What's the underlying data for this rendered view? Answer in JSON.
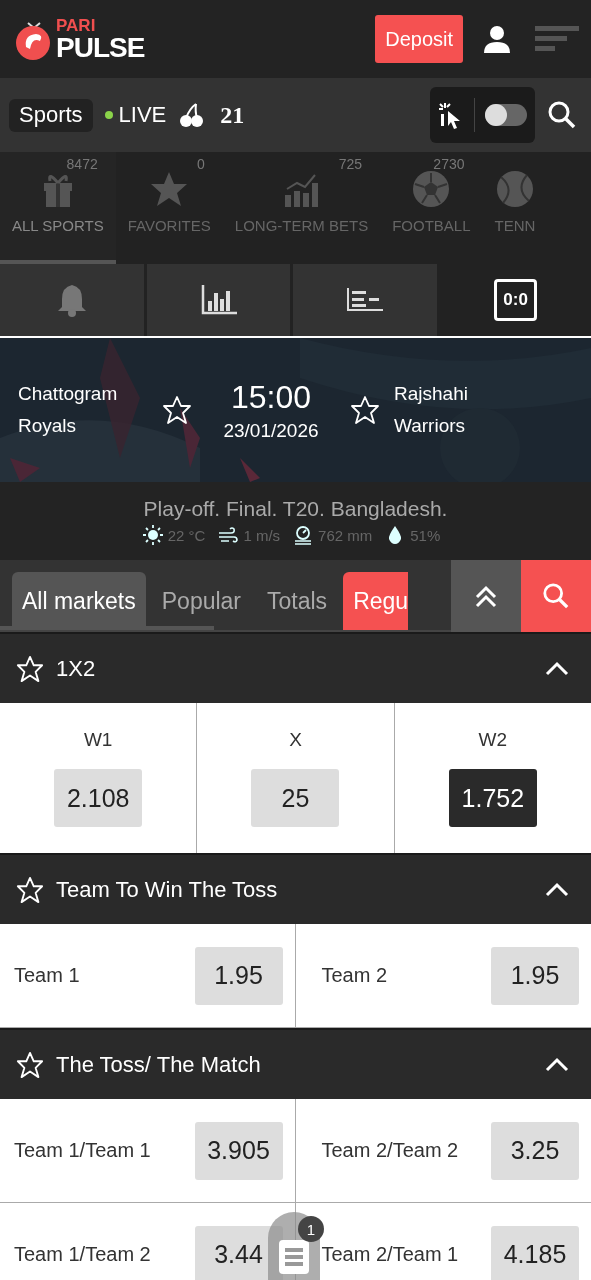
{
  "header": {
    "logo_top": "PARI",
    "logo_bottom": "PULSE",
    "deposit": "Deposit"
  },
  "subbar": {
    "sports": "Sports",
    "live": "LIVE",
    "count": "21",
    "toggle_on": false
  },
  "categories": [
    {
      "kind": "gift",
      "label": "ALL SPORTS",
      "count": "8472",
      "selected": true
    },
    {
      "kind": "star",
      "label": "FAVORITES",
      "count": "0",
      "selected": false
    },
    {
      "kind": "chart",
      "label": "LONG-TERM BETS",
      "count": "725",
      "selected": false
    },
    {
      "kind": "ball",
      "label": "FOOTBALL",
      "count": "2730",
      "selected": false
    },
    {
      "kind": "tennis",
      "label": "TENN",
      "selected": false
    }
  ],
  "match_tabs": [
    {
      "kind": "bell",
      "selected": false
    },
    {
      "kind": "stats",
      "selected": false
    },
    {
      "kind": "lineup",
      "selected": false
    },
    {
      "kind": "score",
      "text": "0:0",
      "selected": true
    }
  ],
  "match": {
    "team1": "Chattogram Royals",
    "team2": "Rajshahi Warriors",
    "time": "15:00",
    "date": "23/01/2026",
    "tournament": "Play-off. Final. T20. Bangladesh.",
    "weather": [
      {
        "kind": "sun",
        "text": "22 °C"
      },
      {
        "kind": "wind",
        "text": "1 m/s"
      },
      {
        "kind": "pressure",
        "text": "762 mm"
      },
      {
        "kind": "humidity",
        "text": "51%"
      }
    ]
  },
  "market_tabs": [
    {
      "label": "All markets",
      "selected": true,
      "highlight": false
    },
    {
      "label": "Popular",
      "selected": false,
      "highlight": false
    },
    {
      "label": "Totals",
      "selected": false,
      "highlight": false
    },
    {
      "label": "Regu",
      "selected": false,
      "highlight": true
    }
  ],
  "markets": [
    {
      "title": "1X2",
      "expanded": true,
      "kind": "columns",
      "outcomes": [
        {
          "label": "W1",
          "odds": "2.108",
          "selected": false
        },
        {
          "label": "X",
          "odds": "25",
          "selected": false
        },
        {
          "label": "W2",
          "odds": "1.752",
          "selected": true
        }
      ]
    },
    {
      "title": "Team To Win The Toss",
      "expanded": true,
      "kind": "pairs",
      "outcomes": [
        {
          "label": "Team 1",
          "odds": "1.95",
          "selected": false
        },
        {
          "label": "Team 2",
          "odds": "1.95",
          "selected": false
        }
      ]
    },
    {
      "title": "The Toss/ The Match",
      "expanded": true,
      "kind": "pairs",
      "outcomes": [
        {
          "label": "Team 1/Team 1",
          "odds": "3.905",
          "selected": false
        },
        {
          "label": "Team 2/Team 2",
          "odds": "3.25",
          "selected": false
        },
        {
          "label": "Team 1/Team 2",
          "odds": "3.44",
          "selected": false
        },
        {
          "label": "Team 2/Team 1",
          "odds": "4.185",
          "selected": false
        }
      ]
    }
  ],
  "betslip": {
    "count": "1"
  }
}
